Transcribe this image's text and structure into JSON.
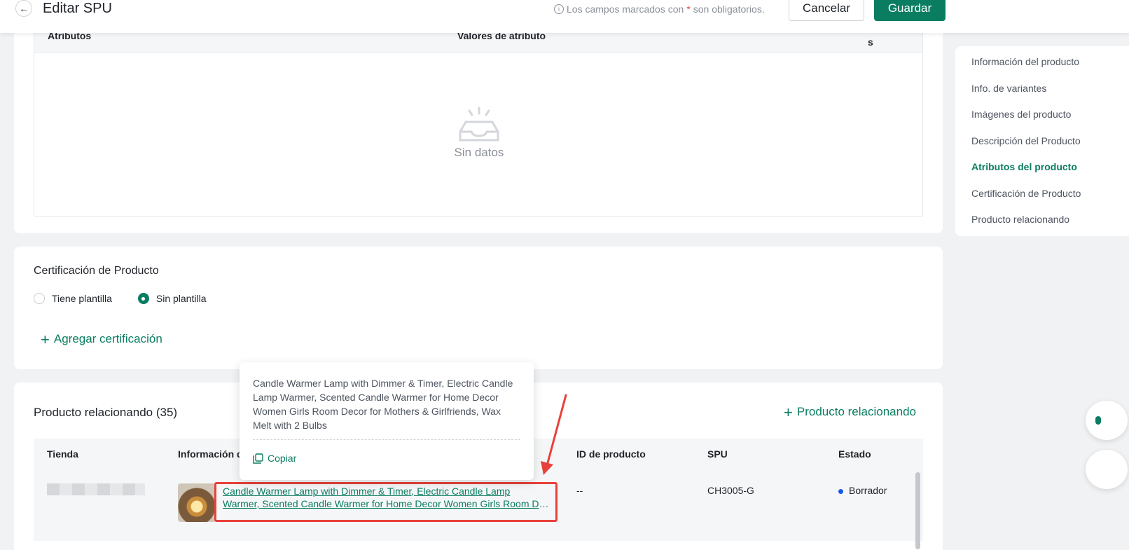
{
  "header": {
    "back_icon": "arrow-left-icon",
    "title": "Editar SPU",
    "required_note_prefix": "Los campos marcados con",
    "required_star": "*",
    "required_note_suffix": "son obligatorios.",
    "cancel_label": "Cancelar",
    "save_label": "Guardar"
  },
  "attributes": {
    "col_attr": "Atributos",
    "col_values": "Valores de atributo",
    "col_extra": "s",
    "empty_text": "Sin datos"
  },
  "certification": {
    "title": "Certificación de Producto",
    "option_template": "Tiene plantilla",
    "option_no_template": "Sin plantilla",
    "selected": "Sin plantilla",
    "add_label": "Agregar certificación"
  },
  "related": {
    "title": "Producto relacionando (35)",
    "add_label": "Producto relacionando",
    "columns": [
      "Tienda",
      "Información d",
      "ID de producto",
      "SPU",
      "Estado"
    ],
    "row": {
      "title_line1": "Candle Warmer Lamp with Dimmer & Timer, Electric Candle Lamp",
      "title_line2": "Warmer, Scented Candle Warmer for Home Decor Women Girls Room Decor for Mothers & Girlfriends, Wax Melt with 2 Bulbs",
      "product_id": "--",
      "spu": "CH3005-G",
      "status": "Borrador",
      "status_color": "#1a56e8"
    }
  },
  "tooltip": {
    "text": "Candle Warmer Lamp with Dimmer & Timer, Electric Candle Lamp Warmer, Scented Candle Warmer for Home Decor Women Girls Room Decor for Mothers & Girlfriends, Wax Melt with 2 Bulbs",
    "copy_label": "Copiar"
  },
  "side_nav": {
    "items": [
      "Información del producto",
      "Info. de variantes",
      "Imágenes del producto",
      "Descripción del Producto",
      "Atributos del producto",
      "Certificación de Producto",
      "Producto relacionando"
    ],
    "active": "Atributos del producto"
  },
  "colors": {
    "brand": "#0a7d61",
    "highlight": "#e8413a"
  }
}
